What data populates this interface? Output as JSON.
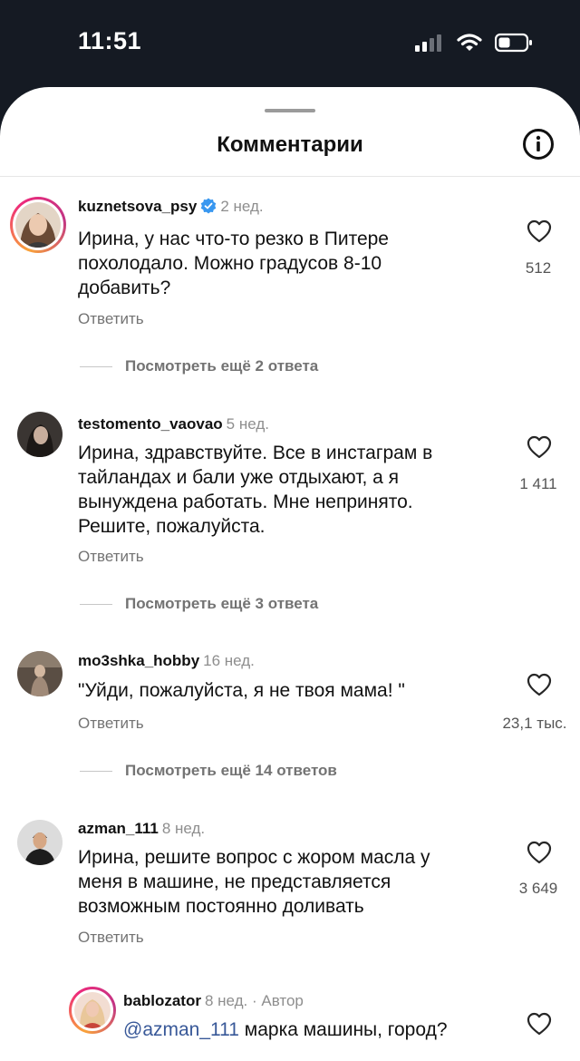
{
  "status": {
    "time": "11:51"
  },
  "header": {
    "title": "Комментарии"
  },
  "comments": [
    {
      "username": "kuznetsova_psy",
      "time": "2 нед.",
      "verified": true,
      "text_lines": [
        "Ирина, у нас что-то резко в Питере",
        "похолодало. Можно градусов 8-10",
        "добавить?"
      ],
      "reply_label": "Ответить",
      "likes": "512",
      "view_more": "Посмотреть ещё 2 ответа"
    },
    {
      "username": "testomento_vaovao",
      "time": "5 нед.",
      "text_lines": [
        "Ирина, здравствуйте. Все в инстаграм в",
        "тайландах и бали уже отдыхают, а я",
        "вынуждена работать. Мне непринято.",
        "Решите, пожалуйста."
      ],
      "reply_label": "Ответить",
      "likes": "1 411",
      "view_more": "Посмотреть ещё 3 ответа"
    },
    {
      "username": "mo3shka_hobby",
      "time": "16 нед.",
      "text_lines": [
        "\"Уйди, пожалуйста, я не твоя мама! \""
      ],
      "reply_label": "Ответить",
      "likes": "23,1 тыс.",
      "view_more": "Посмотреть ещё 14 ответов"
    },
    {
      "username": "azman_111",
      "time": "8 нед.",
      "text_lines": [
        "Ирина, решите вопрос с жором масла у",
        "меня в машине, не представляется",
        "возможным постоянно доливать"
      ],
      "reply_label": "Ответить",
      "likes": "3 649"
    }
  ],
  "reply": {
    "username": "bablozator",
    "time": "8 нед.",
    "separator": "·",
    "author_label": "Автор",
    "mention": "@azman_111",
    "text": " марка машины, город?"
  }
}
